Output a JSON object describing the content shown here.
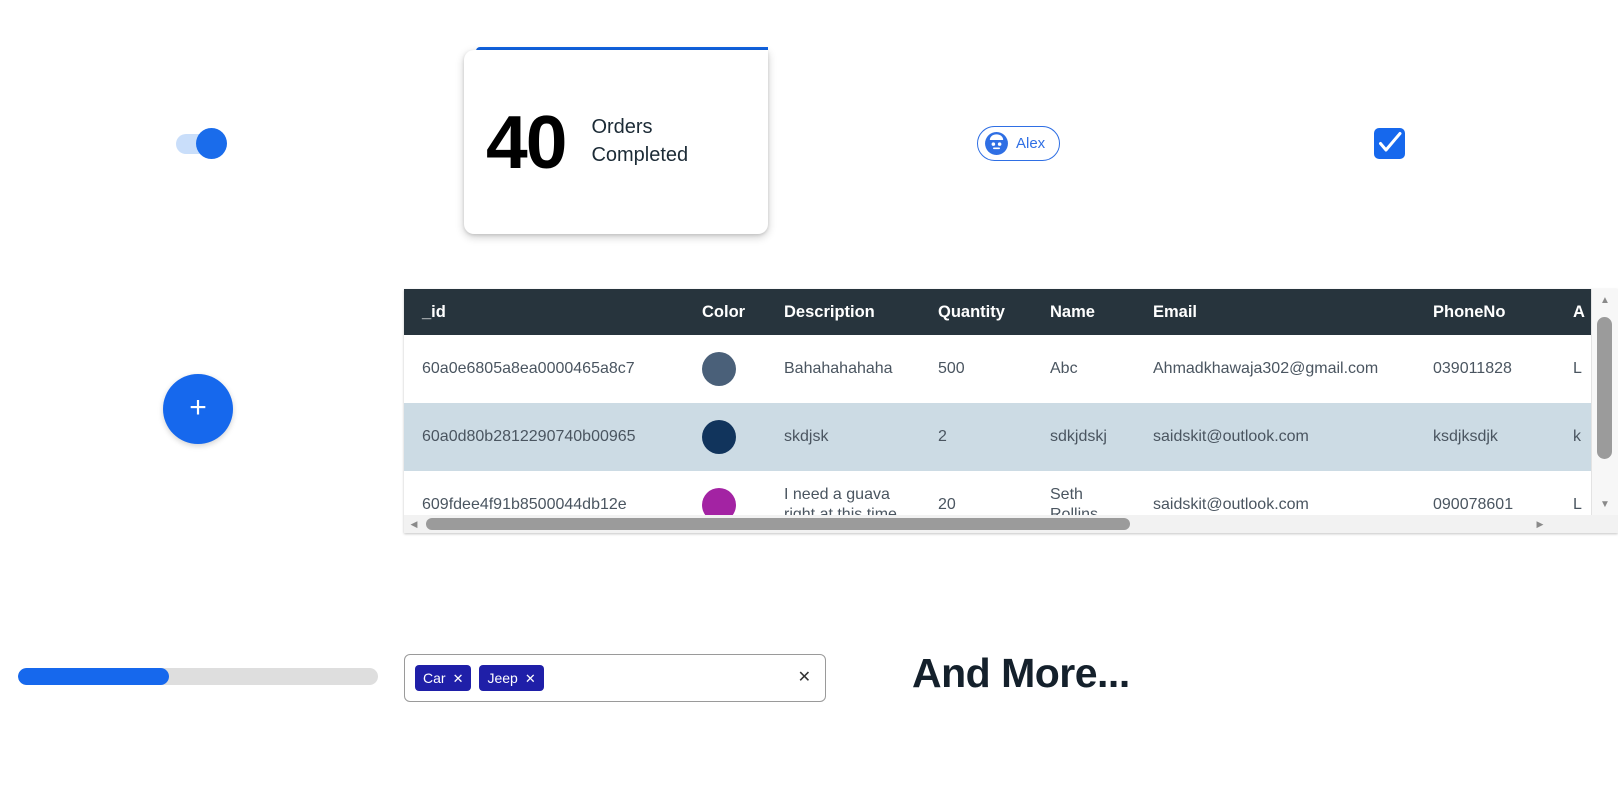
{
  "toggle": {
    "name": "toggle-switch",
    "state": "on"
  },
  "stat_card": {
    "number": "40",
    "label": "Orders Completed",
    "accent_color": "#1263e0"
  },
  "chip": {
    "label": "Alex",
    "icon": "avatar-face-icon",
    "border_color": "#2f6fe4"
  },
  "checkbox": {
    "checked": true,
    "color": "#1668ed",
    "icon": "check-icon"
  },
  "fab": {
    "label": "+",
    "icon": "plus-icon",
    "color": "#1668ed"
  },
  "table": {
    "header_bg": "#27343d",
    "alt_row_bg": "#ccdbe4",
    "columns": [
      "_id",
      "Color",
      "Description",
      "Quantity",
      "Name",
      "Email",
      "PhoneNo",
      "A"
    ],
    "rows": [
      {
        "id": "60a0e6805a8ea0000465a8c7",
        "color": "#4a6079",
        "description": "Bahahahahaha",
        "quantity": "500",
        "name": "Abc",
        "email": "Ahmadkhawaja302@gmail.com",
        "phone": "039011828",
        "address": "L"
      },
      {
        "id": "60a0d80b2812290740b00965",
        "color": "#11345c",
        "description": "skdjsk",
        "quantity": "2",
        "name": "sdkjdskj",
        "email": "saidskit@outlook.com",
        "phone": "ksdjksdjk",
        "address": "k"
      },
      {
        "id": "609fdee4f91b8500044db12e",
        "color": "#a323a3",
        "description": "I need a guava right at this time",
        "quantity": "20",
        "name": "Seth Rollins",
        "email": "saidskit@outlook.com",
        "phone": "090078601",
        "address": "L"
      }
    ]
  },
  "scrollbars": {
    "vertical_up": "▲",
    "vertical_down": "▼",
    "horizontal_left": "◀",
    "horizontal_right": "▶"
  },
  "progress": {
    "percent": 42,
    "fill_color": "#1668ed",
    "track_color": "#dedede"
  },
  "tag_input": {
    "tags": [
      {
        "label": "Car",
        "remove": "✕"
      },
      {
        "label": "Jeep",
        "remove": "✕"
      }
    ],
    "clear": "✕",
    "tag_color": "#1f1fa8"
  },
  "and_more": {
    "text": "And More..."
  }
}
